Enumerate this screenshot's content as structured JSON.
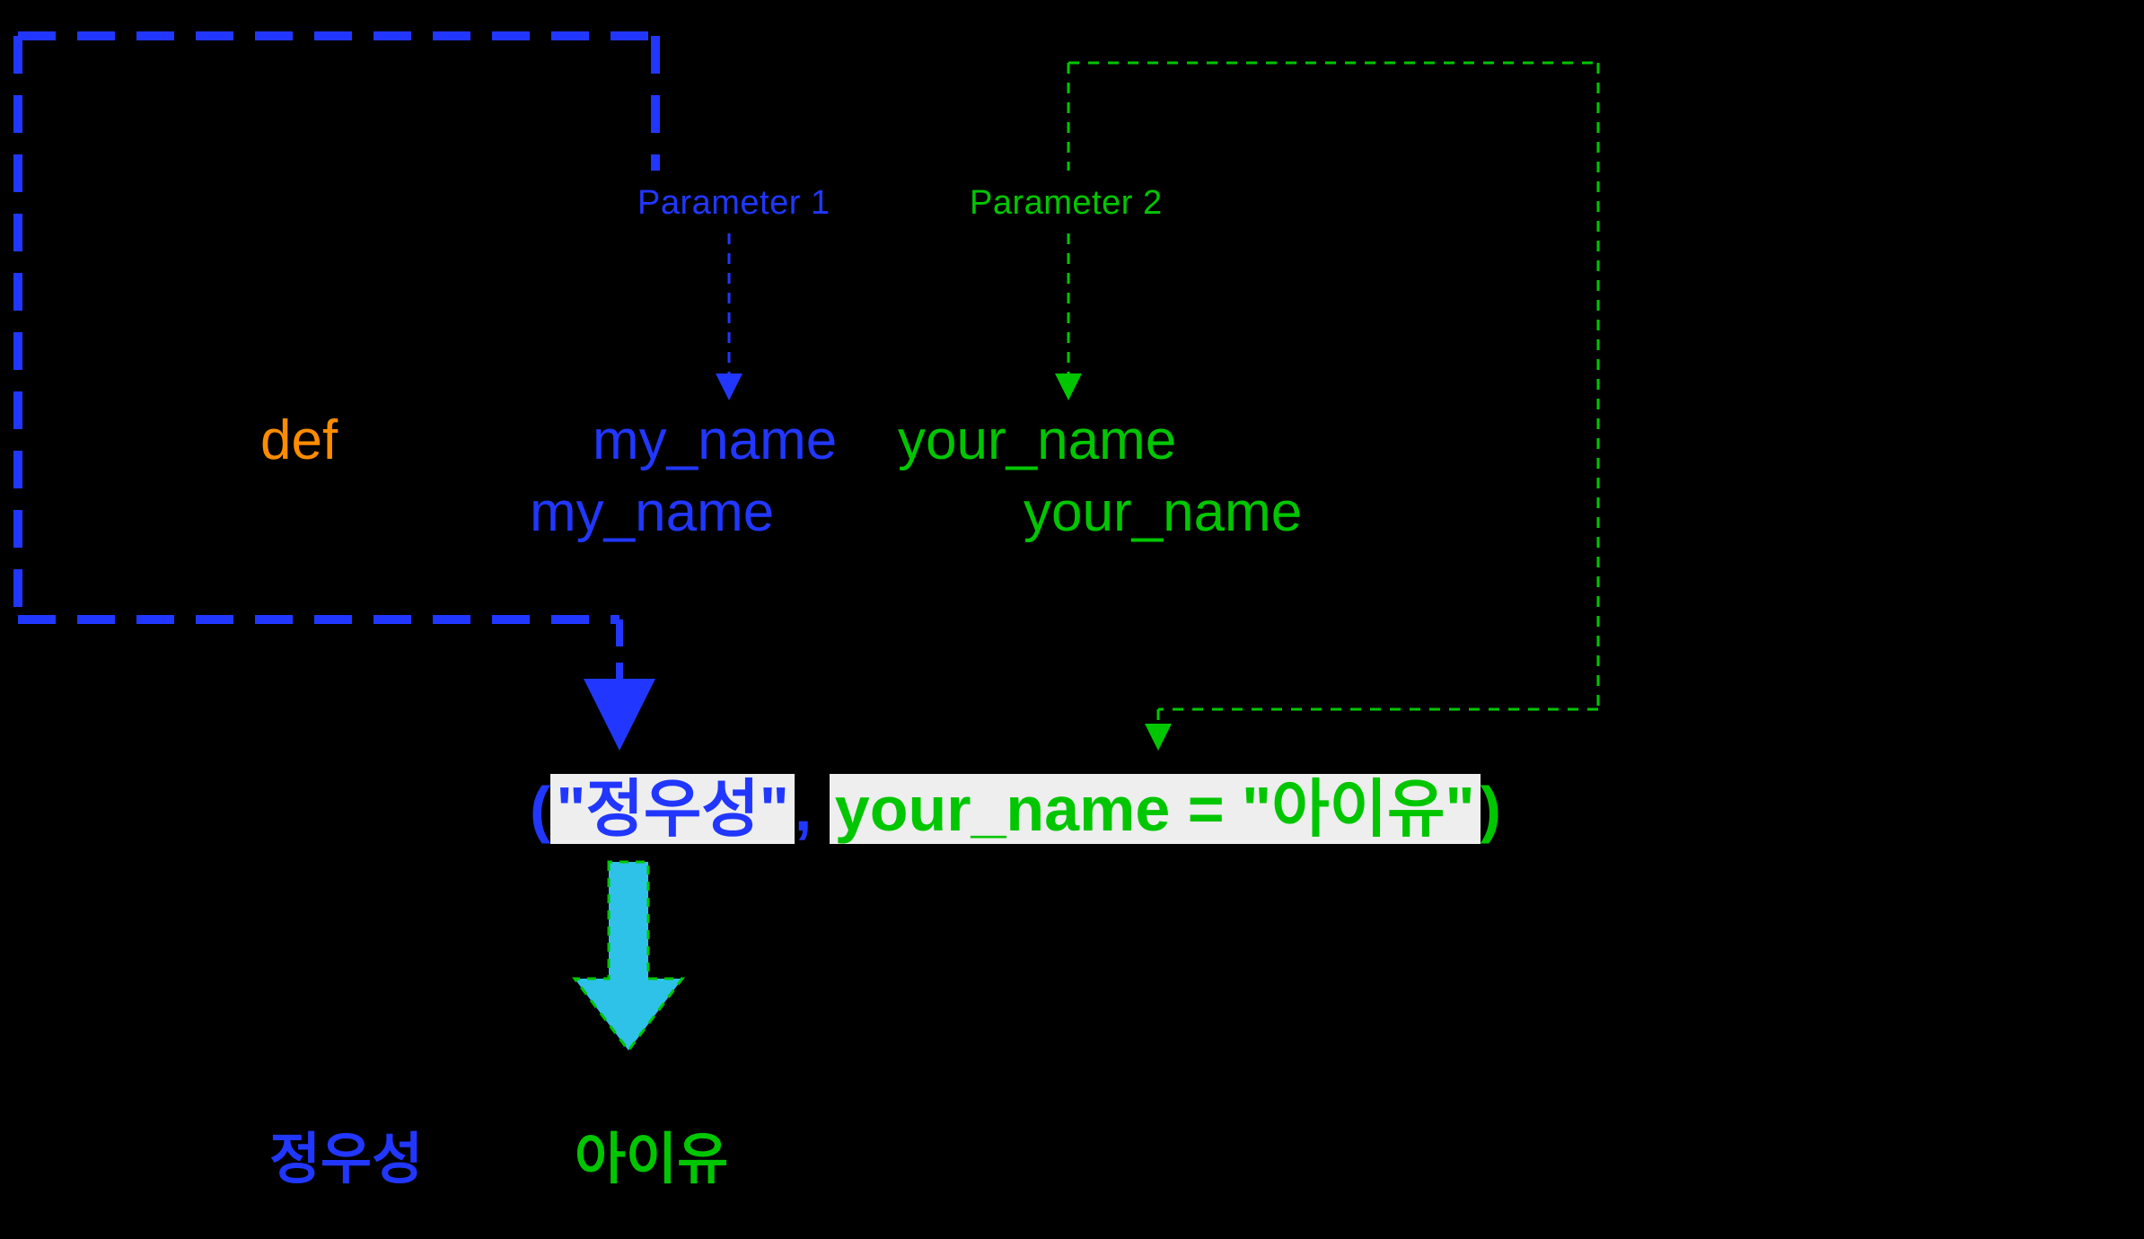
{
  "labels": {
    "param1": "Parameter 1",
    "param2": "Parameter 2"
  },
  "code": {
    "defkw": "def",
    "param1_sig": "my_name",
    "param2_sig": "your_name",
    "body_var1": "my_name",
    "body_var2": "your_name",
    "call_open": "(",
    "call_arg1_quoted": "\"정우성\"",
    "call_comma": ", ",
    "call_arg2": "your_name = \"아이유\"",
    "call_close": ")"
  },
  "output": {
    "left": "정우성",
    "right": "아이유"
  },
  "colors": {
    "blue": "#2137ff",
    "green": "#00c600",
    "orange": "#ff8c00",
    "highlight": "#eeeeee",
    "cyan": "#2ec2e8"
  }
}
